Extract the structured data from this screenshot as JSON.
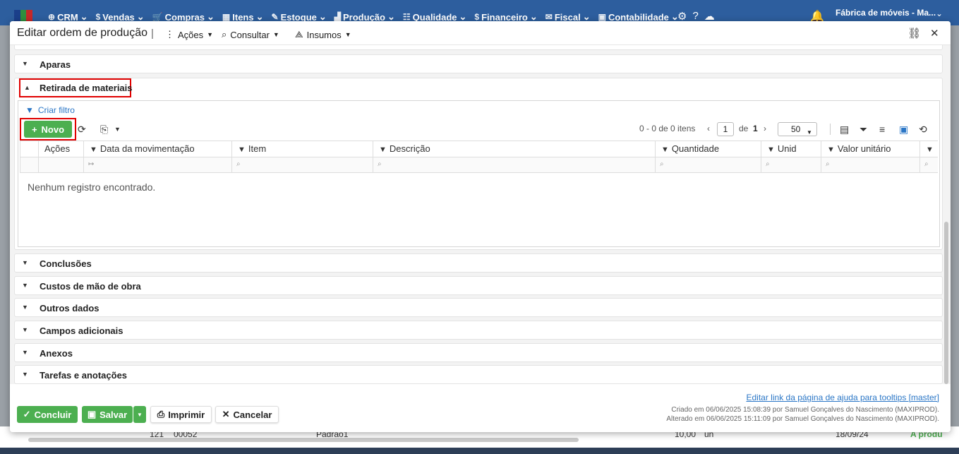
{
  "topnav": {
    "menus": [
      {
        "icon": "crm-icon",
        "glyph": "⊕",
        "label": "CRM"
      },
      {
        "icon": "dollar-icon",
        "glyph": "$",
        "label": "Vendas"
      },
      {
        "icon": "cart-icon",
        "glyph": "🛒",
        "label": "Compras"
      },
      {
        "icon": "grid-icon",
        "glyph": "▦",
        "label": "Itens"
      },
      {
        "icon": "box-icon",
        "glyph": "✎",
        "label": "Estoque"
      },
      {
        "icon": "factory-icon",
        "glyph": "▟",
        "label": "Produção"
      },
      {
        "icon": "quality-icon",
        "glyph": "☷",
        "label": "Qualidade"
      },
      {
        "icon": "money-bag-icon",
        "glyph": "$",
        "label": "Financeiro"
      },
      {
        "icon": "fiscal-icon",
        "glyph": "✉",
        "label": "Fiscal"
      },
      {
        "icon": "calculator-icon",
        "glyph": "▣",
        "label": "Contabilidade"
      }
    ],
    "company": "Fábrica de móveis - Ma..."
  },
  "modal": {
    "title": "Editar ordem de produção",
    "menus": {
      "acoes": "Ações",
      "consultar": "Consultar",
      "insumos": "Insumos"
    }
  },
  "sections": {
    "aparas": "Aparas",
    "retirada": "Retirada de materiais",
    "conclusoes": "Conclusões",
    "custos": "Custos de mão de obra",
    "outros": "Outros dados",
    "campos": "Campos adicionais",
    "anexos": "Anexos",
    "tarefas": "Tarefas e anotações"
  },
  "grid": {
    "filter_link": "Criar filtro",
    "new_button": "Novo",
    "pager": {
      "summary": "0 - 0 de 0 itens",
      "page": "1",
      "of_label": "de",
      "total_pages": "1",
      "page_size": "50"
    },
    "columns": [
      "Ações",
      "Data da movimentação",
      "Item",
      "Descrição",
      "Quantidade",
      "Unid",
      "Valor unitário"
    ],
    "empty_message": "Nenhum registro encontrado."
  },
  "footer": {
    "help_link": "Editar link da página de ajuda para tooltips [master]",
    "created": "Criado em 06/06/2025 15:08:39 por Samuel Gonçalves do Nascimento (MAXIPROD).",
    "updated": "Alterado em 06/06/2025 15:11:09 por Samuel Gonçalves do Nascimento (MAXIPROD).",
    "buttons": {
      "concluir": "Concluir",
      "salvar": "Salvar",
      "imprimir": "Imprimir",
      "cancelar": "Cancelar"
    }
  },
  "background_row": {
    "num": "121",
    "code": "00052",
    "name": "Padrao1",
    "qty": "10,00",
    "unit": "un",
    "date": "18/09/24",
    "status": "A produ"
  },
  "colors": {
    "nav": "#2d5e9e",
    "accent_green": "#4caf50",
    "link_blue": "#2a76c6",
    "highlight_red": "#e00000"
  }
}
